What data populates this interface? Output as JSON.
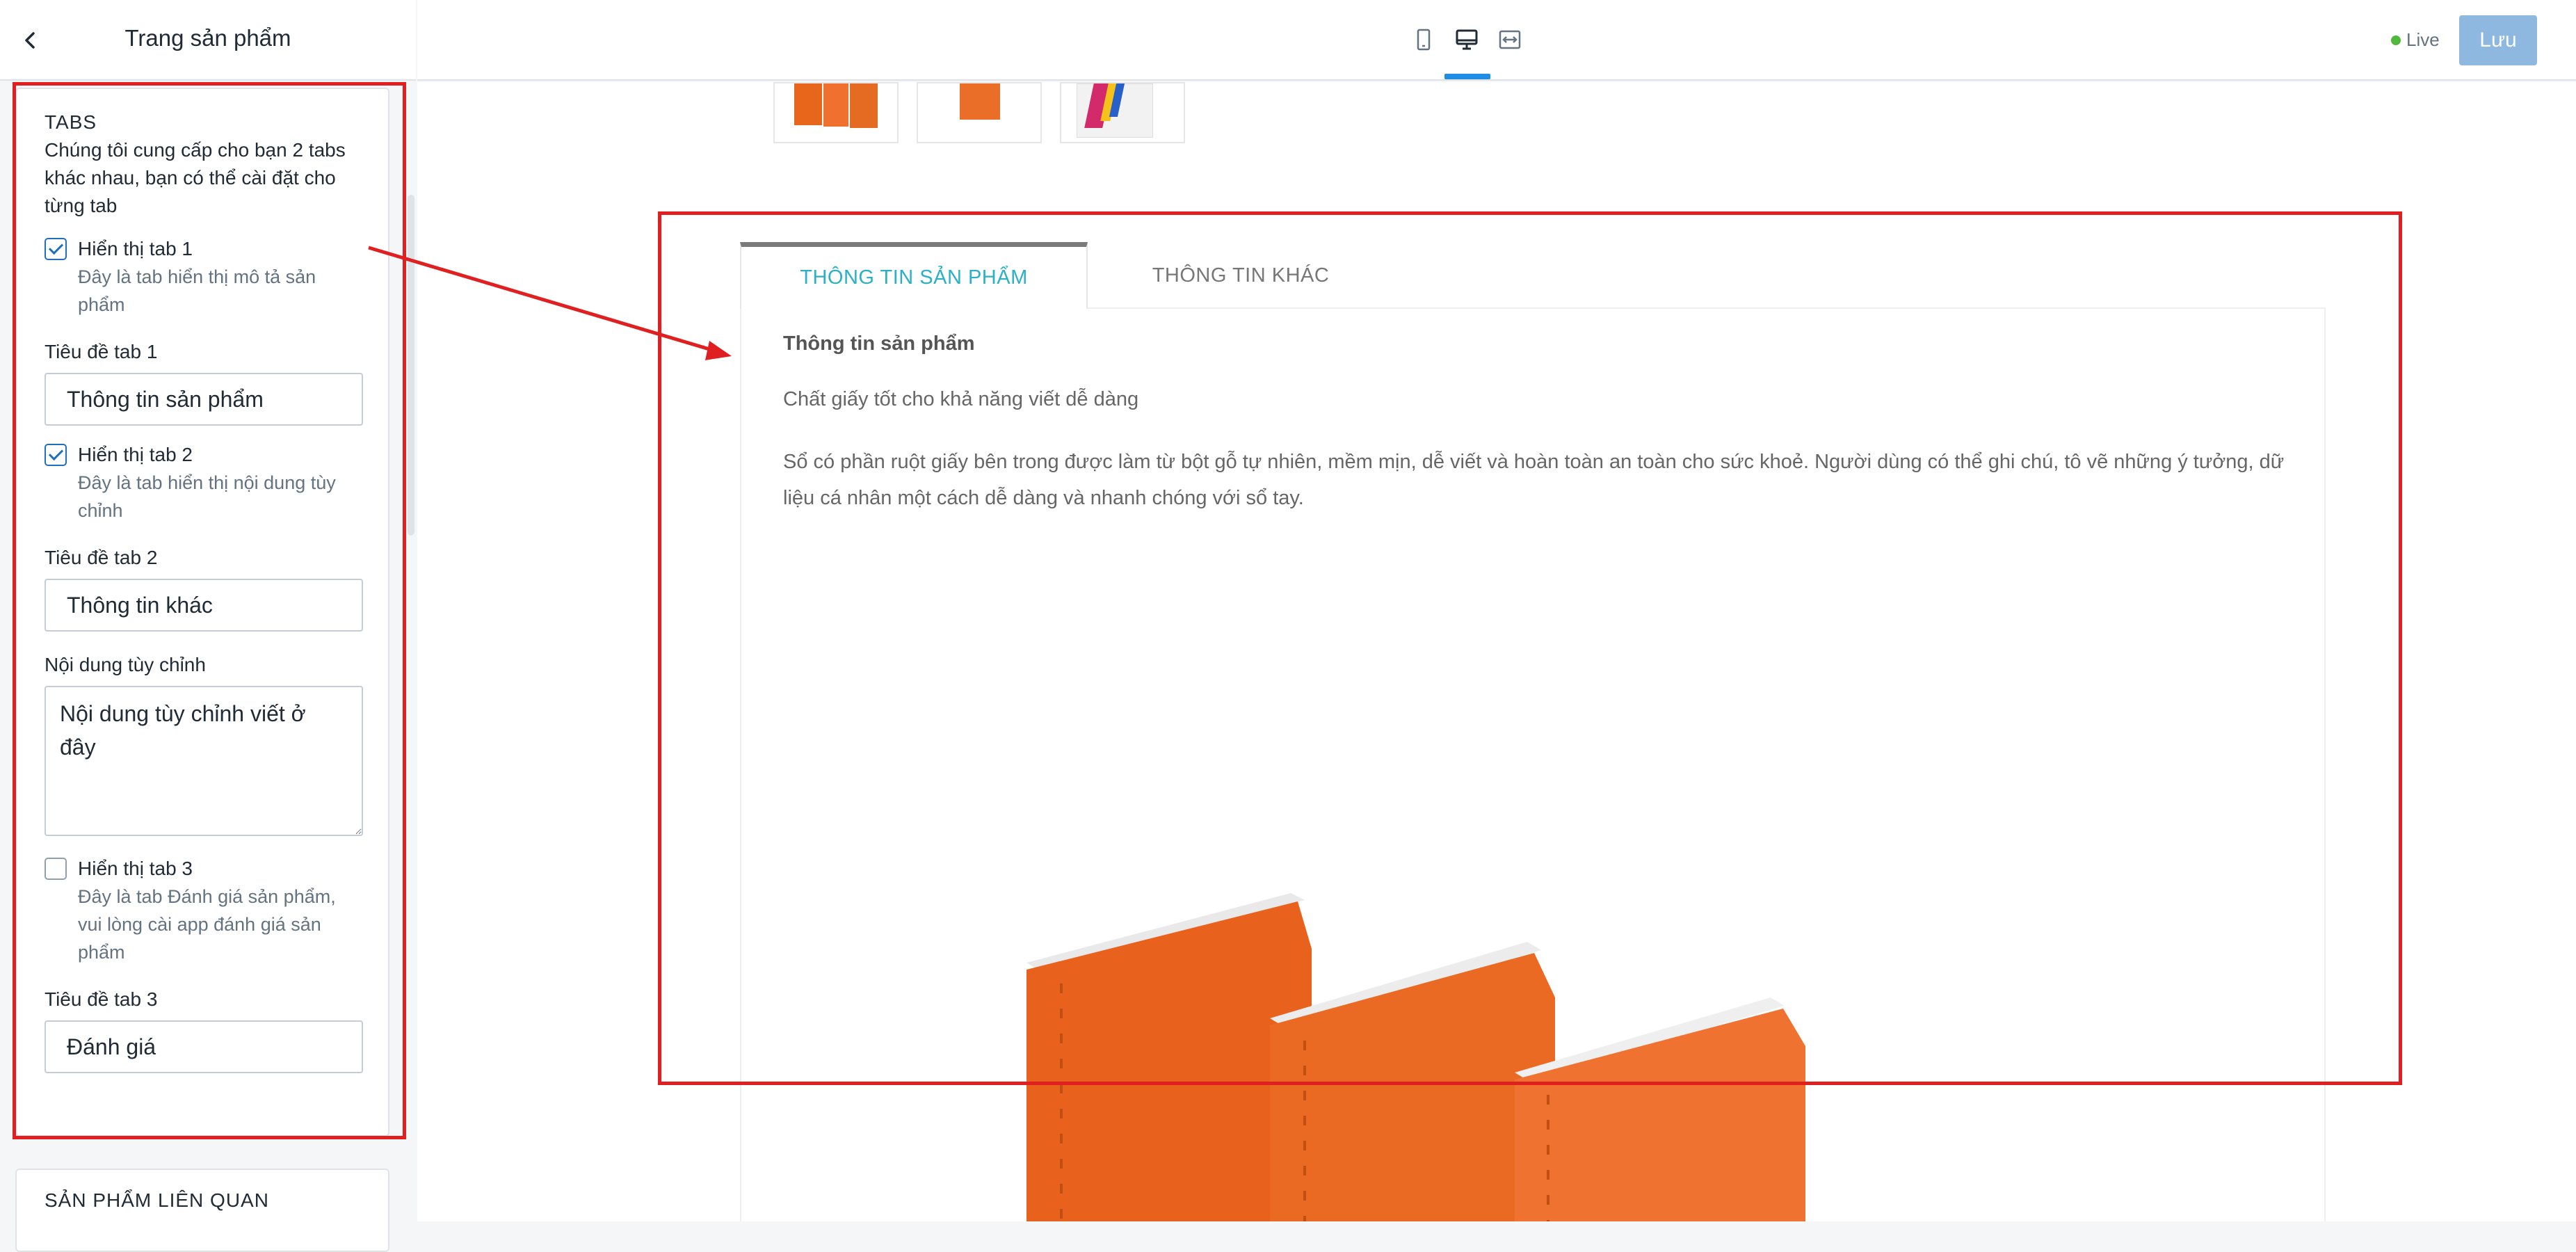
{
  "sidebar": {
    "title": "Trang sản phẩm",
    "tabs_section": {
      "heading": "TABS",
      "description": "Chúng tôi cung cấp cho bạn 2 tabs khác nhau, bạn có thể cài đặt cho từng tab",
      "tab1_checkbox": {
        "label": "Hiển thị tab 1",
        "help": "Đây là tab hiển thị mô tả sản phẩm",
        "checked": true
      },
      "tab1_title_label": "Tiêu đề tab 1",
      "tab1_title_value": "Thông tin sản phẩm",
      "tab2_checkbox": {
        "label": "Hiển thị tab 2",
        "help": "Đây là tab hiển thị nội dung tùy chỉnh",
        "checked": true
      },
      "tab2_title_label": "Tiêu đề tab 2",
      "tab2_title_value": "Thông tin khác",
      "custom_content_label": "Nội dung tùy chỉnh",
      "custom_content_value": "Nội dung tùy chỉnh viết ở đây",
      "tab3_checkbox": {
        "label": "Hiển thị tab 3",
        "help": "Đây là tab Đánh giá sản phẩm, vui lòng cài app đánh giá sản phẩm",
        "checked": false
      },
      "tab3_title_label": "Tiêu đề tab 3",
      "tab3_title_value": "Đánh giá"
    },
    "related_section": {
      "heading": "SẢN PHẨM LIÊN QUAN"
    }
  },
  "topbar": {
    "devices": [
      "mobile-icon",
      "desktop-icon",
      "full-width-icon"
    ],
    "active_device": "desktop",
    "live_label": "Live",
    "live_color": "#50b83c",
    "save_label": "Lưu"
  },
  "preview": {
    "tabs": [
      {
        "label": "THÔNG TIN SẢN PHẨM",
        "active": true
      },
      {
        "label": "THÔNG TIN KHÁC",
        "active": false
      }
    ],
    "panel": {
      "title": "Thông tin sản phẩm",
      "paragraph1": "Chất giấy tốt cho khả năng viết dễ dàng",
      "paragraph2": "Sổ có phần ruột giấy bên trong được làm từ bột gỗ tự nhiên, mềm mịn, dễ viết và hoàn toàn an toàn cho sức khoẻ. Người dùng có thể ghi chú, tô vẽ những ý tưởng, dữ liệu cá nhân một cách dễ dàng và nhanh chóng với sổ tay."
    },
    "accent_color": "#2bb0c8",
    "annotation_color": "#e02020"
  }
}
